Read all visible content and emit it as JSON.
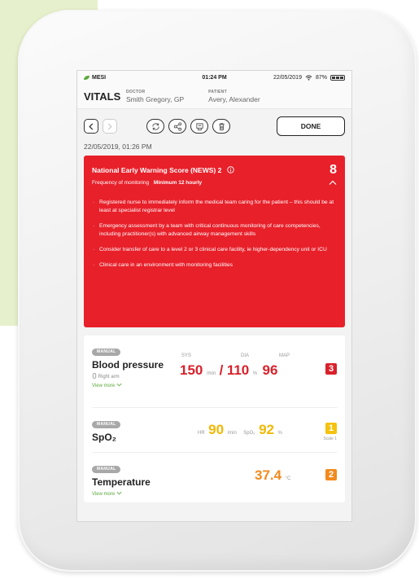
{
  "statusbar": {
    "app": "MESI",
    "time": "01:24 PM",
    "date": "22/05/2019",
    "battery": "87%"
  },
  "header": {
    "title": "VITALS",
    "doctor_label": "DOCTOR",
    "doctor": "Smith Gregory, GP",
    "patient_label": "PATIENT",
    "patient": "Avery, Alexander"
  },
  "toolbar": {
    "done_label": "DONE"
  },
  "timestamp": "22/05/2019, 01:26 PM",
  "news": {
    "title": "National Early Warning Score (NEWS) 2",
    "score": "8",
    "frequency_label": "Frequency of monitoring",
    "frequency_value": "Minimum 12 hourly",
    "items": [
      "Registered nurse to immediately inform the medical team caring for the patient – this should be at least at specialist registrar level",
      "Emergency assessment by a team with critical continuous monitoring of care competencies, including practitioner(s)  with advanced airway management skills",
      "Consider transfer of care to a level 2 or 3 clinical care facility, ie higher-dependency unit or ICU",
      "Clinical care in an environment with monitoring facilities"
    ]
  },
  "vitals": {
    "bp": {
      "tag": "MANUAL",
      "name": "Blood pressure",
      "site": "Right arm",
      "more": "View more",
      "sys_label": "SYS",
      "dia_label": "DIA",
      "map_label": "MAP",
      "sys": "150",
      "sys_unit": "/min",
      "sep": "/",
      "dia": "110",
      "dia_unit": "%",
      "map": "96",
      "score": "3"
    },
    "spo2": {
      "tag": "MANUAL",
      "name": "SpO₂",
      "hr_label": "HR",
      "hr": "90",
      "hr_unit": "/min",
      "spo2_label": "SpO₂",
      "spo2": "92",
      "spo2_unit": "%",
      "score": "1",
      "scale": "Scale 1"
    },
    "temp": {
      "tag": "MANUAL",
      "name": "Temperature",
      "more": "View more",
      "value": "37.4",
      "unit": "°C",
      "score": "2"
    }
  },
  "colors": {
    "alert_red": "#e8202a",
    "score_red": "#d9212b",
    "score_yellow": "#f5c20e",
    "score_orange": "#f28a1d",
    "brand_green": "#5aaa3a"
  }
}
